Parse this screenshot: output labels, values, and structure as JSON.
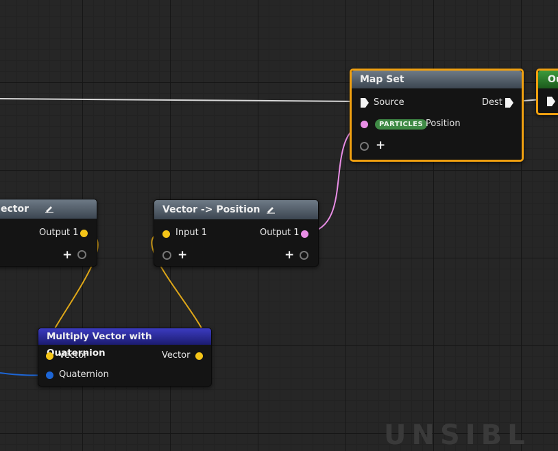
{
  "colors": {
    "position_pin": "#e98ee6",
    "vector_pin": "#f5c518",
    "quaternion_pin": "#1d66d6",
    "selection": "#f0a010",
    "annotation": "#e3110e"
  },
  "nodes": {
    "partial_left": {
      "title": "ector",
      "output": "Output 1"
    },
    "vector_to_position": {
      "title": "Vector -> Position",
      "input": "Input 1",
      "output": "Output 1"
    },
    "multiply": {
      "title": "Multiply Vector with Quaternion",
      "input_vector": "Vector",
      "input_quaternion": "Quaternion",
      "output": "Vector"
    },
    "map_set": {
      "title": "Map Set",
      "source": "Source",
      "dest": "Dest",
      "badge": "PARTICLES",
      "attribute": "Position"
    },
    "output_partial": {
      "title": "Ou"
    }
  },
  "watermark": "UNSIBL"
}
